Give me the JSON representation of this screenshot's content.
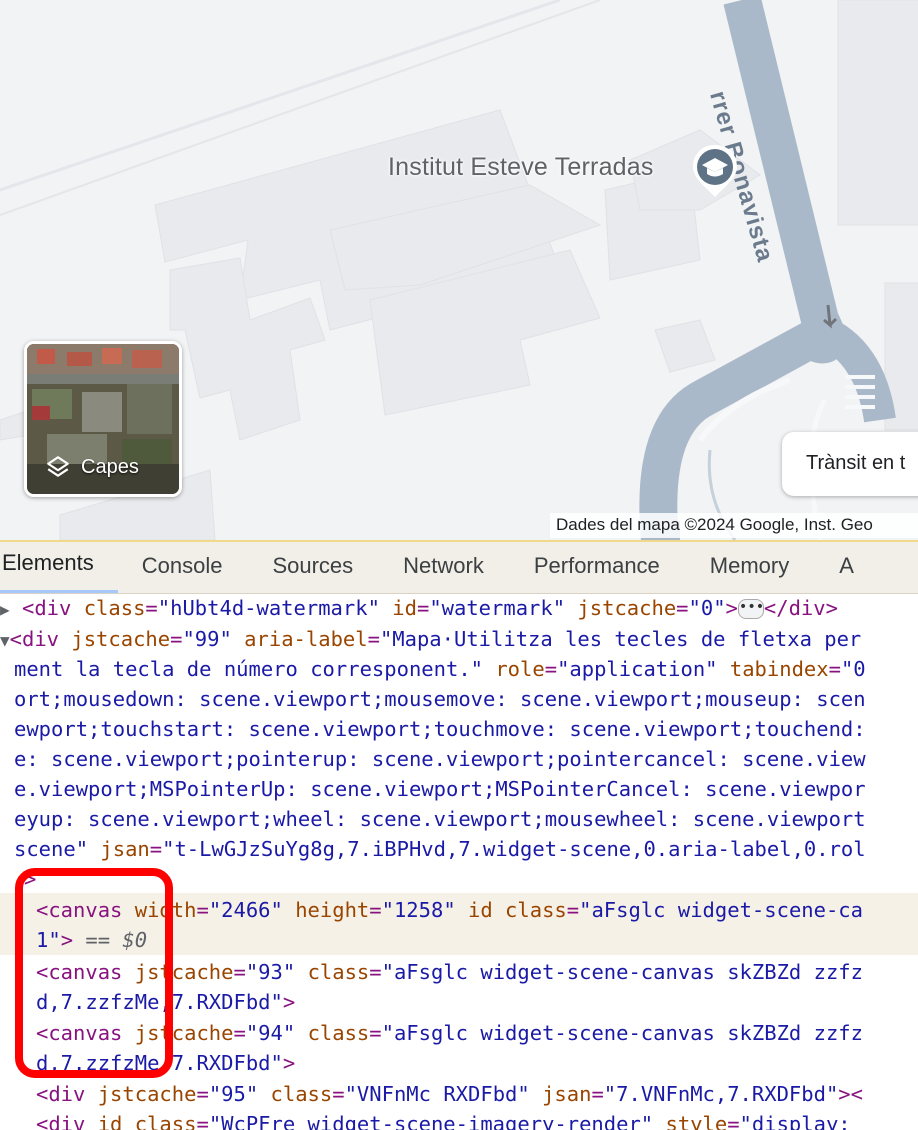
{
  "map": {
    "poi_label": "Institut Esteve Terradas",
    "street_label": "rrer Bonavista",
    "layers_label": "Capes",
    "transit_chip": "Trànsit en t",
    "attribution": "Dades del mapa ©2024 Google, Inst. Geo"
  },
  "devtools": {
    "tabs": [
      "Elements",
      "Console",
      "Sources",
      "Network",
      "Performance",
      "Memory",
      "A"
    ],
    "active_tab": "Elements",
    "lines": {
      "l1_tag": "<div",
      "l1_a1": "class",
      "l1_v1": "\"hUbt4d-watermark\"",
      "l1_a2": "id",
      "l1_v2": "\"watermark\"",
      "l1_a3": "jstcache",
      "l1_v3": "\"0\"",
      "l1_close": "</div>",
      "l2_tag": "<div",
      "l2_a1": "jstcache",
      "l2_v1": "\"99\"",
      "l2_a2": "aria-label",
      "l2_v2": "\"Mapa·Utilitza les tecles de fletxa per",
      "l3": "ment la tecla de número corresponent.\"",
      "l3_a1": "role",
      "l3_v1": "\"application\"",
      "l3_a2": "tabindex",
      "l3_v2": "\"0",
      "l4": "ort;mousedown: scene.viewport;mousemove: scene.viewport;mouseup: scen",
      "l5": "ewport;touchstart: scene.viewport;touchmove: scene.viewport;touchend:",
      "l6": "e: scene.viewport;pointerup: scene.viewport;pointercancel: scene.view",
      "l7": "e.viewport;MSPointerUp: scene.viewport;MSPointerCancel: scene.viewpor",
      "l8": "eyup: scene.viewport;wheel: scene.viewport;mousewheel: scene.viewport",
      "l9": "scene\"",
      "l9_a1": "jsan",
      "l9_v1": "\"t-LwGJzSuYg8g,7.iBPHvd,7.widget-scene,0.aria-label,0.rol",
      "l10": ">",
      "l11_tag": "<canvas",
      "l11_a1": "width",
      "l11_v1": "\"2466\"",
      "l11_a2": "height",
      "l11_v2": "\"1258\"",
      "l11_a3": "id class",
      "l11_v3": "\"aFsglc widget-scene-ca",
      "l12_v": "1\"",
      "l12_p": ">",
      "l12_eq": " == ",
      "l12_dollar": "$0",
      "l13_tag": "<canvas",
      "l13_a1": "jstcache",
      "l13_v1": "\"93\"",
      "l13_a2": "class",
      "l13_v2": "\"aFsglc widget-scene-canvas skZBZd zzfz",
      "l14": "d,7.zzfzMe,7.RXDFbd\"",
      "l14_p": ">",
      "l15_tag": "<canvas",
      "l15_a1": "jstcache",
      "l15_v1": "\"94\"",
      "l15_a2": "class",
      "l15_v2": "\"aFsglc widget-scene-canvas skZBZd zzfz",
      "l16": "d,7.zzfzMe,7.RXDFbd\"",
      "l16_p": ">",
      "l17_tag": "<div",
      "l17_a1": "jstcache",
      "l17_v1": "\"95\"",
      "l17_a2": "class",
      "l17_v2": "\"VNFnMc RXDFbd\"",
      "l17_a3": "jsan",
      "l17_v3": "\"7.VNFnMc,7.RXDFbd\"",
      "l17_end": "><",
      "l18_tag": "<div",
      "l18_a1": "id class",
      "l18_v1": "\"WcPFre widget-scene-imagery-render\"",
      "l18_a2": "style",
      "l18_v2": "\"display:"
    }
  },
  "colors": {
    "highlight": "#ff0000",
    "road": "#aab9c9",
    "building": "#e8eaed"
  }
}
